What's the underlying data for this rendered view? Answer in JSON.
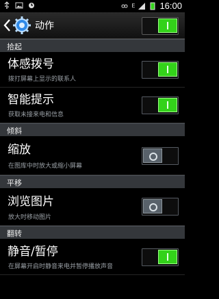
{
  "status": {
    "time": "16:00",
    "battery_text": "E"
  },
  "header": {
    "title": "动作"
  },
  "sections": [
    {
      "label": "拾起"
    },
    {
      "label": "倾斜"
    },
    {
      "label": "平移"
    },
    {
      "label": "翻转"
    }
  ],
  "items": [
    {
      "title": "体感拨号",
      "subtitle": "拨打屏幕上显示的联系人",
      "state": "on"
    },
    {
      "title": "智能提示",
      "subtitle": "获取未接来电和信息",
      "state": "on"
    },
    {
      "title": "缩放",
      "subtitle": "在图库中时放大或缩小屏幕",
      "state": "off"
    },
    {
      "title": "浏览图片",
      "subtitle": "放大时移动图片",
      "state": "off"
    },
    {
      "title": "静音/暂停",
      "subtitle": "在屏幕开启时静音来电并暂停播放声音",
      "state": "on"
    }
  ],
  "icons": [
    "usb-icon",
    "image-icon",
    "alarm-icon",
    "vibrate-icon",
    "signal-icon",
    "battery-icon",
    "back-arrow-icon",
    "gear-icon"
  ]
}
